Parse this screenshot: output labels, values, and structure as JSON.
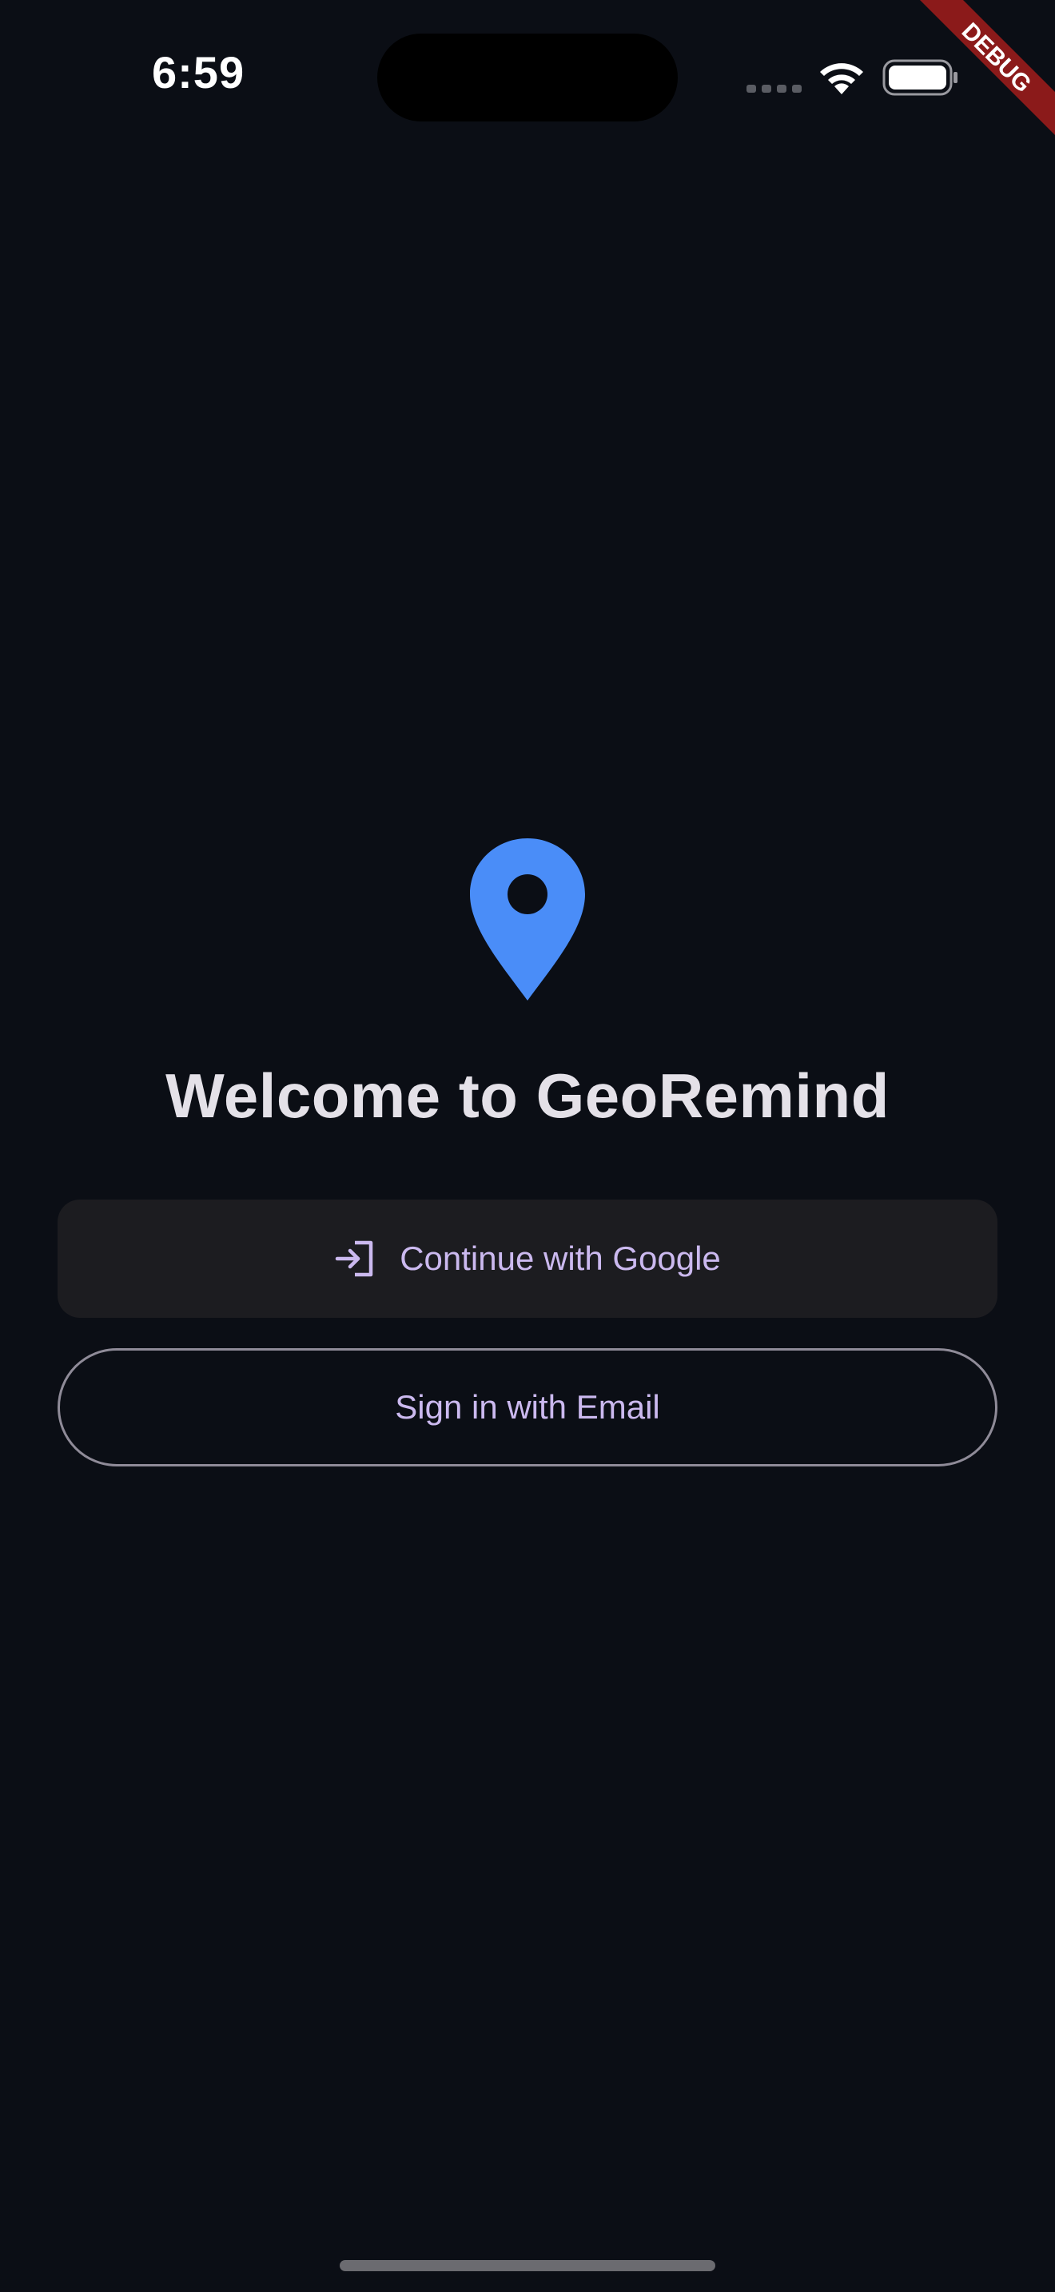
{
  "status_bar": {
    "time": "6:59"
  },
  "debug_banner": {
    "label": "DEBUG",
    "color": "#8b1a1a"
  },
  "welcome": {
    "title": "Welcome to GeoRemind",
    "logo_icon": "location-pin-icon",
    "logo_color": "#4a8df8"
  },
  "actions": {
    "google_label": "Continue with Google",
    "google_icon": "login-icon",
    "email_label": "Sign in with Email"
  },
  "colors": {
    "background": "#0b0e15",
    "accent_text": "#cbb9ef"
  }
}
